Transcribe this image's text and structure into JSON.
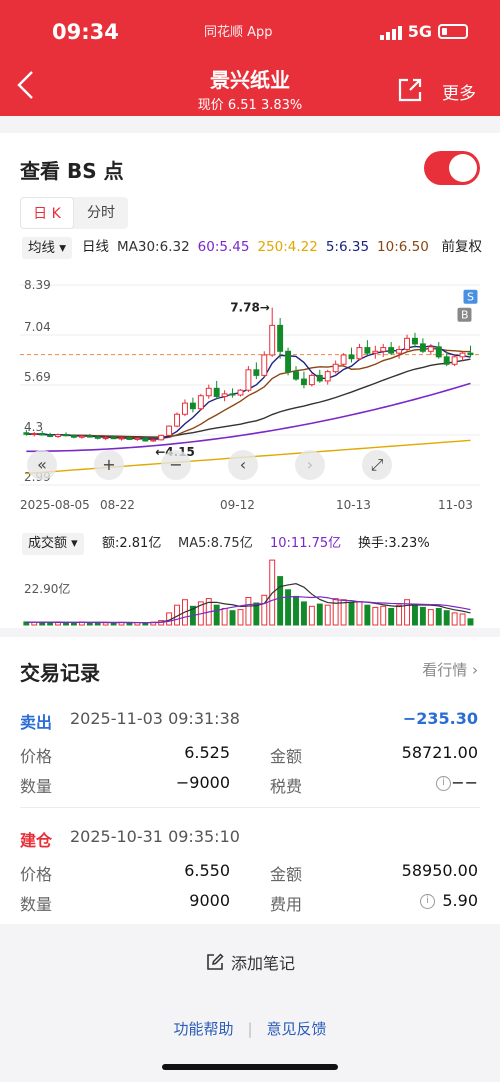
{
  "status_bar": {
    "time": "09:34",
    "app_name": "同花顺 App",
    "network": "5G"
  },
  "header": {
    "title": "景兴纸业",
    "price_line": "现价 6.51 3.83%",
    "more_label": "更多",
    "back_icon": "chevron-left-icon",
    "share_icon": "share-icon"
  },
  "bs": {
    "title": "查看 BS 点",
    "toggle_on": true
  },
  "period_tabs": [
    {
      "label": "日 K",
      "active": true
    },
    {
      "label": "分时",
      "active": false
    }
  ],
  "ma_bar": {
    "select_label": "均线",
    "items": [
      {
        "text": "日线",
        "color": "#222222"
      },
      {
        "text": "MA30:6.32",
        "color": "#333333"
      },
      {
        "text": "60:5.45",
        "color": "#7a28c8"
      },
      {
        "text": "250:4.22",
        "color": "#e0a800"
      },
      {
        "text": "5:6.35",
        "color": "#1a237e"
      },
      {
        "text": "10:6.50",
        "color": "#8b4513"
      }
    ],
    "restore_label": "前复权"
  },
  "chart_data": [
    {
      "type": "candlestick",
      "title": "",
      "y_ticks": [
        "8.39",
        "7.04",
        "5.69",
        "4.3",
        "2.99"
      ],
      "x_ticks": [
        "2025-08-05",
        "08-22",
        "09-12",
        "10-13",
        "11-03"
      ],
      "ylim": [
        2.99,
        8.39
      ],
      "reference_line": 6.51,
      "annotations": [
        {
          "text": "7.78→",
          "value": 7.78
        },
        {
          "text": "←4.15",
          "value": 4.15
        }
      ],
      "markers": [
        "S",
        "B"
      ],
      "controls": [
        "«",
        "+",
        "−",
        "‹",
        "›",
        "⤢"
      ],
      "candles": [
        [
          4.4,
          4.48,
          4.32,
          4.36
        ],
        [
          4.36,
          4.42,
          4.3,
          4.38
        ],
        [
          4.38,
          4.45,
          4.33,
          4.34
        ],
        [
          4.34,
          4.4,
          4.28,
          4.3
        ],
        [
          4.3,
          4.38,
          4.26,
          4.35
        ],
        [
          4.35,
          4.41,
          4.3,
          4.32
        ],
        [
          4.32,
          4.36,
          4.25,
          4.28
        ],
        [
          4.28,
          4.34,
          4.24,
          4.31
        ],
        [
          4.31,
          4.37,
          4.27,
          4.29
        ],
        [
          4.29,
          4.33,
          4.22,
          4.25
        ],
        [
          4.25,
          4.31,
          4.2,
          4.27
        ],
        [
          4.27,
          4.33,
          4.23,
          4.24
        ],
        [
          4.24,
          4.3,
          4.19,
          4.26
        ],
        [
          4.26,
          4.31,
          4.21,
          4.22
        ],
        [
          4.22,
          4.28,
          4.18,
          4.25
        ],
        [
          4.25,
          4.29,
          4.16,
          4.18
        ],
        [
          4.18,
          4.24,
          4.15,
          4.21
        ],
        [
          4.21,
          4.35,
          4.19,
          4.33
        ],
        [
          4.33,
          4.6,
          4.31,
          4.58
        ],
        [
          4.58,
          4.95,
          4.55,
          4.9
        ],
        [
          4.9,
          5.3,
          4.85,
          5.2
        ],
        [
          5.2,
          5.35,
          4.95,
          5.05
        ],
        [
          5.05,
          5.45,
          5.0,
          5.4
        ],
        [
          5.4,
          5.7,
          5.32,
          5.6
        ],
        [
          5.6,
          5.8,
          5.3,
          5.38
        ],
        [
          5.38,
          5.55,
          5.25,
          5.45
        ],
        [
          5.45,
          5.6,
          5.35,
          5.42
        ],
        [
          5.42,
          5.58,
          5.38,
          5.55
        ],
        [
          5.55,
          6.2,
          5.5,
          6.1
        ],
        [
          6.1,
          6.3,
          5.85,
          5.95
        ],
        [
          5.95,
          6.6,
          5.9,
          6.5
        ],
        [
          6.5,
          7.78,
          6.45,
          7.3
        ],
        [
          7.3,
          7.5,
          6.4,
          6.6
        ],
        [
          6.6,
          6.7,
          5.95,
          6.05
        ],
        [
          6.05,
          6.2,
          5.8,
          5.85
        ],
        [
          5.85,
          6.05,
          5.6,
          5.7
        ],
        [
          5.7,
          6.0,
          5.65,
          5.95
        ],
        [
          5.95,
          6.1,
          5.75,
          5.8
        ],
        [
          5.8,
          6.1,
          5.7,
          6.05
        ],
        [
          6.05,
          6.35,
          6.0,
          6.25
        ],
        [
          6.25,
          6.55,
          6.2,
          6.5
        ],
        [
          6.5,
          6.7,
          6.3,
          6.4
        ],
        [
          6.4,
          6.8,
          6.35,
          6.7
        ],
        [
          6.7,
          6.9,
          6.5,
          6.55
        ],
        [
          6.55,
          6.75,
          6.4,
          6.6
        ],
        [
          6.6,
          6.8,
          6.45,
          6.7
        ],
        [
          6.7,
          6.85,
          6.5,
          6.55
        ],
        [
          6.55,
          6.75,
          6.4,
          6.65
        ],
        [
          6.65,
          7.05,
          6.6,
          6.95
        ],
        [
          6.95,
          7.1,
          6.7,
          6.8
        ],
        [
          6.8,
          6.95,
          6.55,
          6.6
        ],
        [
          6.6,
          6.8,
          6.5,
          6.72
        ],
        [
          6.72,
          6.85,
          6.4,
          6.45
        ],
        [
          6.45,
          6.6,
          6.2,
          6.25
        ],
        [
          6.25,
          6.5,
          6.2,
          6.45
        ],
        [
          6.45,
          6.6,
          6.35,
          6.55
        ],
        [
          6.55,
          6.75,
          6.45,
          6.51
        ]
      ]
    },
    {
      "type": "bar",
      "title": "成交额",
      "y_ticks": [
        "22.90亿"
      ],
      "ylim": [
        0,
        30
      ],
      "series": [
        {
          "name": "额:2.81亿",
          "values": [
            1.4,
            1.3,
            1.2,
            1.3,
            1.1,
            1.2,
            1.0,
            1.3,
            1.1,
            1.2,
            1.0,
            1.1,
            1.2,
            1.0,
            1.1,
            1.0,
            1.3,
            2.0,
            5.5,
            9.0,
            11.5,
            8.5,
            10.5,
            12.0,
            9.0,
            7.5,
            6.5,
            7.0,
            12.5,
            10.0,
            13.5,
            29.5,
            22.0,
            16.0,
            13.0,
            10.5,
            8.5,
            9.5,
            9.0,
            12.0,
            11.5,
            10.0,
            10.5,
            9.0,
            8.0,
            8.5,
            7.5,
            9.0,
            11.5,
            9.5,
            8.0,
            7.0,
            7.5,
            6.5,
            5.5,
            5.0,
            2.81
          ]
        },
        {
          "name": "MA5:8.75亿",
          "values": [
            1.3,
            1.3,
            1.3,
            1.3,
            1.2,
            1.2,
            1.2,
            1.2,
            1.2,
            1.2,
            1.2,
            1.1,
            1.1,
            1.1,
            1.1,
            1.1,
            1.1,
            1.3,
            2.2,
            4.0,
            5.9,
            7.3,
            9.0,
            10.3,
            10.3,
            9.6,
            9.2,
            8.4,
            8.6,
            8.8,
            9.8,
            14.5,
            17.5,
            18.2,
            18.8,
            17.2,
            14.0,
            11.6,
            10.2,
            9.9,
            10.1,
            10.4,
            10.6,
            10.4,
            9.8,
            9.2,
            8.7,
            8.4,
            8.9,
            9.1,
            9.1,
            9.0,
            8.7,
            7.7,
            6.9,
            6.3,
            5.5
          ]
        },
        {
          "name": "10:11.75亿",
          "values": [
            1.3,
            1.3,
            1.3,
            1.3,
            1.3,
            1.2,
            1.2,
            1.2,
            1.2,
            1.2,
            1.2,
            1.2,
            1.2,
            1.2,
            1.1,
            1.1,
            1.1,
            1.2,
            1.7,
            2.6,
            3.6,
            4.3,
            5.1,
            5.9,
            6.6,
            7.4,
            8.1,
            8.7,
            9.3,
            9.5,
            9.7,
            11.2,
            12.3,
            12.8,
            12.9,
            12.7,
            12.5,
            12.8,
            12.4,
            11.5,
            11.2,
            11.1,
            10.5,
            10.4,
            10.1,
            10.0,
            9.8,
            9.7,
            9.6,
            9.5,
            9.4,
            9.3,
            9.2,
            8.9,
            8.3,
            7.7,
            7.0
          ]
        }
      ],
      "extra_label": "换手:3.23%"
    }
  ],
  "volume_header": {
    "select_label": "成交额",
    "amount": "额:2.81亿",
    "ma5": "MA5:8.75亿",
    "ma10": "10:11.75亿",
    "turnover": "换手:3.23%"
  },
  "records": {
    "title": "交易记录",
    "more_label": "看行情 ›",
    "trades": [
      {
        "type": "卖出",
        "time": "2025-11-03 09:31:38",
        "pnl": "−235.30",
        "price_label": "价格",
        "price": "6.525",
        "amount_label": "金额",
        "amount": "58721.00",
        "qty_label": "数量",
        "qty": "−9000",
        "fee_label": "税费",
        "fee": "−−"
      },
      {
        "type": "建仓",
        "time": "2025-10-31 09:35:10",
        "pnl": "",
        "price_label": "价格",
        "price": "6.550",
        "amount_label": "金额",
        "amount": "58950.00",
        "qty_label": "数量",
        "qty": "9000",
        "fee_label": "费用",
        "fee": "5.90"
      }
    ]
  },
  "note_button": "添加笔记",
  "footer": {
    "help": "功能帮助",
    "feedback": "意见反馈"
  },
  "colors": {
    "red": "#e8303a",
    "green": "#128a2a",
    "blue": "#2b6dd6",
    "purple": "#7a28c8",
    "gold": "#e0a800"
  }
}
